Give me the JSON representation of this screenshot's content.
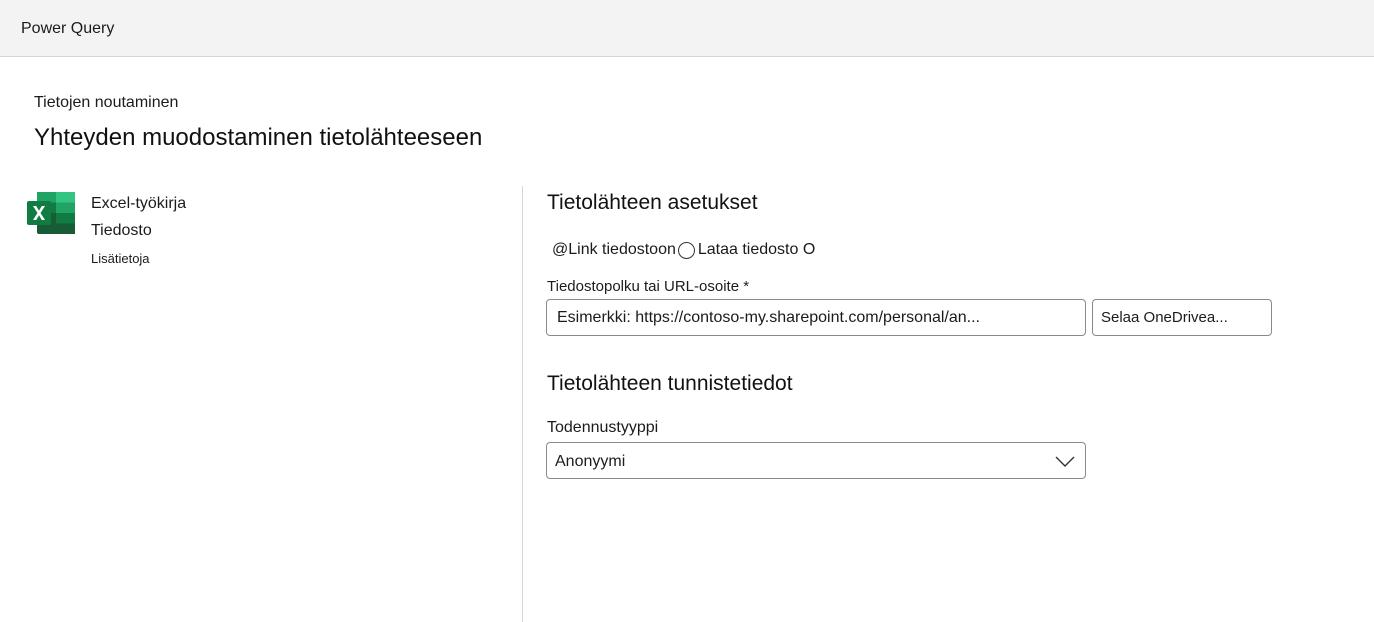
{
  "app": {
    "title": "Power Query"
  },
  "header": {
    "breadcrumb": "Tietojen noutaminen",
    "title": "Yhteyden muodostaminen tietolähteeseen"
  },
  "source": {
    "icon": "excel-workbook-icon",
    "name": "Excel-työkirja",
    "category": "Tiedosto",
    "learn_more": "Lisätietoja"
  },
  "settings": {
    "title": "Tietolähteen asetukset",
    "radio_link": "@Link tiedostoon",
    "radio_upload": "Lataa tiedosto O",
    "path_label": "Tiedostopolku tai URL-osoite *",
    "path_placeholder": "Esimerkki: https://contoso-my.sharepoint.com/personal/an...",
    "browse_label": "Selaa OneDrivea..."
  },
  "credentials": {
    "title": "Tietolähteen tunnistetiedot",
    "auth_label": "Todennustyyppi",
    "auth_value": "Anonyymi"
  },
  "colors": {
    "excel_dark": "#185c37",
    "excel_mid": "#21a366",
    "excel_light": "#33c481",
    "excel_badge": "#107c41",
    "topbar": "#f3f3f3",
    "divider": "#d6d6d6"
  }
}
